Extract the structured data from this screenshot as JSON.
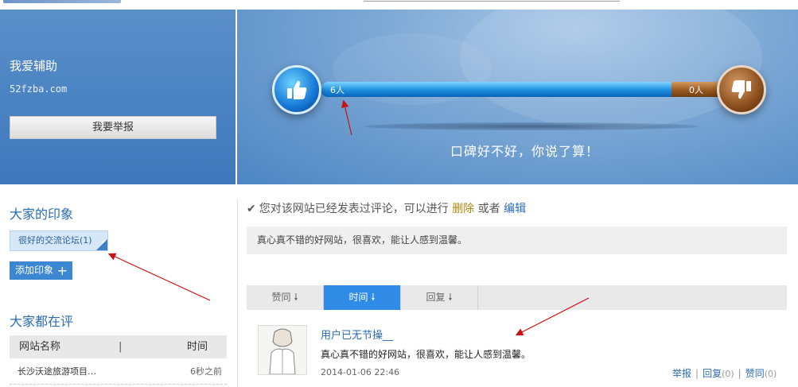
{
  "site": {
    "name": "我爱辅助",
    "url": "52fzba.com",
    "report_label": "我要举报"
  },
  "banner": {
    "good_count": "6人",
    "bad_count": "0人",
    "good_ratio": 0.84,
    "slogan": "口碑好不好，你说了算！"
  },
  "impressions": {
    "title": "大家的印象",
    "tags": [
      {
        "label": "很好的交流论坛(1)"
      }
    ],
    "add_label": "添加印象"
  },
  "reviewing": {
    "title": "大家都在评",
    "headers": {
      "name": "网站名称",
      "time": "时间",
      "separator": "|"
    },
    "rows": [
      {
        "name": "长沙沃途旅游项目…",
        "time": "6秒之前"
      }
    ]
  },
  "notice": {
    "text": "您对该网站已经发表过评论，可以进行",
    "delete_label": "删除",
    "or_label": "或者",
    "edit_label": "编辑"
  },
  "my_comment": "真心真不错的好网站，很喜欢，能让人感到温馨。",
  "sort_tabs": [
    {
      "label": "赞同",
      "active": false
    },
    {
      "label": "时间",
      "active": true
    },
    {
      "label": "回复",
      "active": false
    }
  ],
  "review": {
    "username": "用户已无节操__",
    "text": "真心真不错的好网站，很喜欢，能让人感到温馨。",
    "time": "2014-01-06 22:46",
    "report_label": "举报",
    "reply_label": "回复",
    "reply_count": "(0)",
    "agree_label": "赞同",
    "agree_count": "(0)"
  },
  "colors": {
    "accent": "#2f8be6",
    "link": "#2b6cb4",
    "delete": "#b8860b",
    "annotation": "#cc1111"
  },
  "icons": [
    "thumbs-up-icon",
    "thumbs-down-icon",
    "check-icon",
    "plus-icon",
    "arrow-down-icon"
  ]
}
